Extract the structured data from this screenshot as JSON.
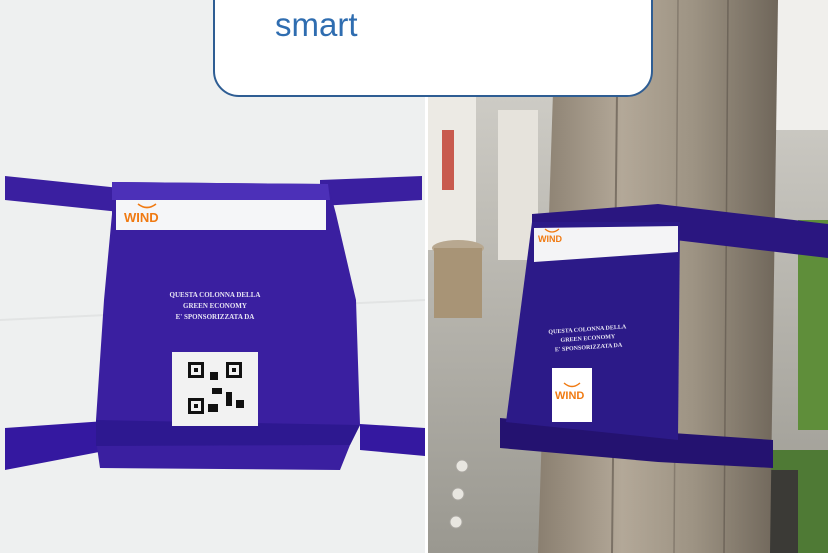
{
  "callout": {
    "text": "smart"
  },
  "left_photo": {
    "logo_text": "WIND",
    "sign_lines": [
      "QUESTA COLONNA DELLA",
      "GREEN ECONOMY",
      "E' SPONSORIZZATA DA"
    ]
  },
  "right_photo": {
    "logo_text": "WIND",
    "sign_lines": [
      "QUESTA COLONNA DELLA",
      "GREEN ECONOMY",
      "E' SPONSORIZZATA DA"
    ]
  },
  "colors": {
    "banner_blue": "#3a1fa0",
    "banner_dark": "#2a1680",
    "brand_orange": "#f07a12",
    "callout_border": "#2e5d93",
    "callout_text": "#2f6db0"
  }
}
